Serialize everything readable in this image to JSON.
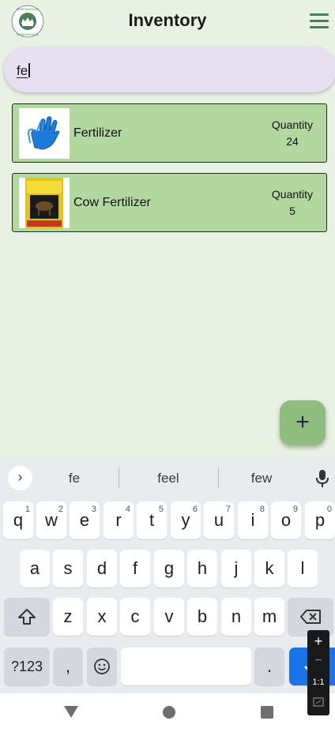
{
  "header": {
    "title": "Inventory",
    "logo_text": "GREENHOUSE"
  },
  "search": {
    "value": "fe"
  },
  "items": [
    {
      "name": "Fertilizer",
      "quantity_label": "Quantity",
      "quantity": "24",
      "image": "blue-gloves"
    },
    {
      "name": "Cow Fertilizer",
      "quantity_label": "Quantity",
      "quantity": "5",
      "image": "black-kow-bag",
      "image_text": "BLACK KOW"
    }
  ],
  "fab": {
    "label": "+"
  },
  "keyboard": {
    "suggestions": [
      "fe",
      "feel",
      "few"
    ],
    "row1": [
      {
        "key": "q",
        "hint": "1"
      },
      {
        "key": "w",
        "hint": "2"
      },
      {
        "key": "e",
        "hint": "3"
      },
      {
        "key": "r",
        "hint": "4"
      },
      {
        "key": "t",
        "hint": "5"
      },
      {
        "key": "y",
        "hint": "6"
      },
      {
        "key": "u",
        "hint": "7"
      },
      {
        "key": "i",
        "hint": "8"
      },
      {
        "key": "o",
        "hint": "9"
      },
      {
        "key": "p",
        "hint": "0"
      }
    ],
    "row2": [
      "a",
      "s",
      "d",
      "f",
      "g",
      "h",
      "j",
      "k",
      "l"
    ],
    "row3": [
      "z",
      "x",
      "c",
      "v",
      "b",
      "n",
      "m"
    ],
    "symbols_key": "?123",
    "comma_key": ",",
    "period_key": "."
  },
  "zoom": {
    "plus": "+",
    "minus": "−",
    "ratio": "1:1"
  },
  "colors": {
    "background": "#e8f1e4",
    "card": "#b2d8a0",
    "fab": "#8fbd7d",
    "accent": "#4b7e58",
    "search": "#e6dff0"
  }
}
